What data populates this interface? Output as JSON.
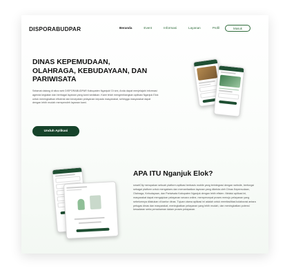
{
  "nav": {
    "brand": "DISPORABUDPAR",
    "items": [
      {
        "label": "Beranda",
        "active": true
      },
      {
        "label": "Event",
        "active": false
      },
      {
        "label": "Informasi",
        "active": false
      },
      {
        "label": "Layanan",
        "active": false
      },
      {
        "label": "Profil",
        "active": false
      }
    ],
    "login_label": "Masuk"
  },
  "hero": {
    "title": "DINAS KEPEMUDAAN, OLAHRAGA, KEBUDAYAAN, DAN PARIWISATA",
    "description": "Selamat datang di situs web DISPORABUDPAR Kabupaten Nganjuk! Di sini, Anda dapat menjelajahi informasi agenda kegiatan dan berbagai layanan yang kami sediakan. Kami telah mengembangkan aplikasi Nganjuk Elok untuk meningkatkan efisiensi dan kecepatan pelayanan kepada masyarakat, sehingga masyarakat dapat dengan lebih mudah memperoleh layanan kami.",
    "download_label": "Unduh Aplikasi"
  },
  "about": {
    "title": "APA ITU Nganjuk Elok?",
    "description": "smartCity merupakan sebuah platform aplikasi berbasis mobile yang terintegrasi dengan website, berfungsi sebagai platform untuk mengakses dan memanfaatkan layanan yang dikelola oleh Dinas Kepemudaan, Olahraga, Kebudayaan, dan Pariwisata Kabupaten Nganjuk dengan lebih efisien. Melalui aplikasi ini, masyarakat dapat mengajukan pelayanan secara online, mempercepat proses menuju pelayanan yang sebelumnya dilakukan di kantor dinas. Tujuan utama aplikasi ini adalah untuk memfasilitasi kolaborasi antara petugas dinas dan masyarakat, meningkatkan pelayanan yang lebih mudah, dan meningkatkan potensi kesadaran serta pemahaman dalam proses pelayanan."
  },
  "colors": {
    "primary": "#16432a",
    "accent": "#2e6b3a"
  }
}
